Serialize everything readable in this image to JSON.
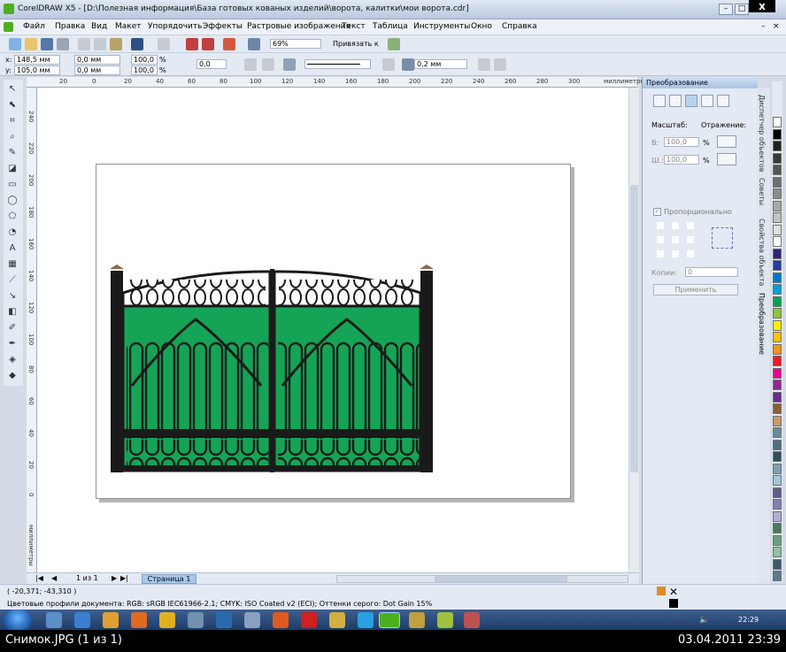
{
  "window": {
    "title": "CorelDRAW X5 - [D:\\Полезная информация\\База готовых  кованых изделий\\ворота, калитки\\мои ворота.cdr]",
    "close_label": "x"
  },
  "menu": [
    "Файл",
    "Правка",
    "Вид",
    "Макет",
    "Упорядочить",
    "Эффекты",
    "Растровые изображения",
    "Текст",
    "Таблица",
    "Инструменты",
    "Окно",
    "Справка"
  ],
  "toolbar": {
    "zoom_value": "69%",
    "snap_label": "Привязать к"
  },
  "propbar": {
    "x_label": "x:",
    "x_value": "148,5 мм",
    "y_label": "y:",
    "y_value": "105,0 мм",
    "w_value": "0,0 мм",
    "h_value": "0,0 мм",
    "scale_x": "100,0",
    "scale_y": "100,0",
    "percent": "%",
    "angle_value": "0,0",
    "outline_width": "0,2 мм"
  },
  "ruler": {
    "h_ticks": [
      "20",
      "0",
      "20",
      "40",
      "60",
      "80",
      "100",
      "120",
      "140",
      "160",
      "180",
      "200",
      "220",
      "240",
      "260",
      "280",
      "300"
    ],
    "h_units": "миллиметры",
    "v_ticks": [
      "240",
      "220",
      "200",
      "180",
      "160",
      "140",
      "120",
      "100",
      "80",
      "60",
      "40",
      "20",
      "0"
    ],
    "v_units": "миллиметры"
  },
  "docker": {
    "title": "Преобразование",
    "scale_label": "Масштаб:",
    "mirror_label": "Отражение:",
    "h_label": "В:",
    "h_value": "100,0",
    "w_label": "Ш.:",
    "w_value": "100,0",
    "percent": "%",
    "proportional_label": "Пропорционально",
    "copies_label": "Копии:",
    "copies_value": "0",
    "apply_label": "Применить"
  },
  "side_tabs": [
    "Диспетчер объектов",
    "Советы",
    "Свойства объекта",
    "Преобразование"
  ],
  "pagebar": {
    "page_counter": "1 из 1",
    "page_tab": "Страница 1"
  },
  "status": {
    "coords": "( -20,371; -43,310 )",
    "color_profile": "Цветовые профили документа: RGB: sRGB IEC61966-2.1; CMYK: ISO Coated v2 (ECI); Оттенки серого: Dot Gain 15%"
  },
  "taskbar": {
    "clock": "22:29"
  },
  "viewer": {
    "title": "Снимок.JPG (1 из 1)",
    "date": "03.04.2011 23:39"
  },
  "palette_colors": [
    "#ffffff",
    "#000000",
    "#1f1f1f",
    "#3a3a3a",
    "#555555",
    "#707070",
    "#8c8c8c",
    "#a8a8a8",
    "#c4c4c4",
    "#e0e0e0",
    "#ffffff",
    "#33227a",
    "#1f3fa0",
    "#0077c8",
    "#00a2d8",
    "#00a550",
    "#8cc63f",
    "#fff200",
    "#ffc20e",
    "#f7941d",
    "#ed1c24",
    "#ec008c",
    "#92278f",
    "#662d91",
    "#8b5e3c",
    "#c49a6c",
    "#6d8a99",
    "#4f6f7f",
    "#2f4f5f",
    "#7f9fb0",
    "#a6c8d6",
    "#5e5e8e",
    "#8080b0",
    "#b0b0d0",
    "#4a7a5a",
    "#6aa07a",
    "#8fc09f",
    "#3a5a6a",
    "#5a7a8a"
  ],
  "colors": {
    "gate_fill": "#15a456",
    "gate_iron": "#1a1a1a",
    "title_bar": "#c7d6ea"
  }
}
